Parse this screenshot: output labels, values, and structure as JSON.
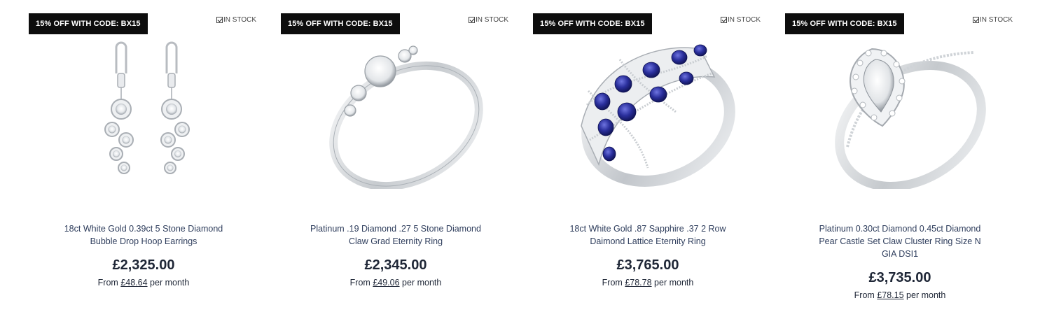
{
  "products": [
    {
      "badge": "15% OFF WITH CODE: BX15",
      "stock": "IN STOCK",
      "image_icon": "diamond-drop-earrings",
      "name": "18ct White Gold 0.39ct 5 Stone Diamond Bubble Drop Hoop Earrings",
      "price": "£2,325.00",
      "finance_prefix": "From",
      "finance_amount": "£48.64",
      "finance_suffix": "per month"
    },
    {
      "badge": "15% OFF WITH CODE: BX15",
      "stock": "IN STOCK",
      "image_icon": "diamond-trilogy-ring",
      "name": "Platinum .19 Diamond .27 5 Stone Diamond Claw Grad Eternity Ring",
      "price": "£2,345.00",
      "finance_prefix": "From",
      "finance_amount": "£49.06",
      "finance_suffix": "per month"
    },
    {
      "badge": "15% OFF WITH CODE: BX15",
      "stock": "IN STOCK",
      "image_icon": "sapphire-lattice-ring",
      "name": "18ct White Gold .87 Sapphire .37 2 Row Daimond Lattice Eternity Ring",
      "price": "£3,765.00",
      "finance_prefix": "From",
      "finance_amount": "£78.78",
      "finance_suffix": "per month"
    },
    {
      "badge": "15% OFF WITH CODE: BX15",
      "stock": "IN STOCK",
      "image_icon": "pear-halo-diamond-ring",
      "name": "Platinum 0.30ct Diamond 0.45ct Diamond Pear Castle Set Claw Cluster Ring Size N GIA DSI1",
      "price": "£3,735.00",
      "finance_prefix": "From",
      "finance_amount": "£78.15",
      "finance_suffix": "per month"
    }
  ],
  "colors": {
    "badge_bg": "#0d0d0d",
    "badge_text": "#ffffff",
    "name_text": "#2e3d5c",
    "price_text": "#1e2636",
    "sapphire": "#2a2f9c",
    "metal": "#d9dcdf"
  }
}
